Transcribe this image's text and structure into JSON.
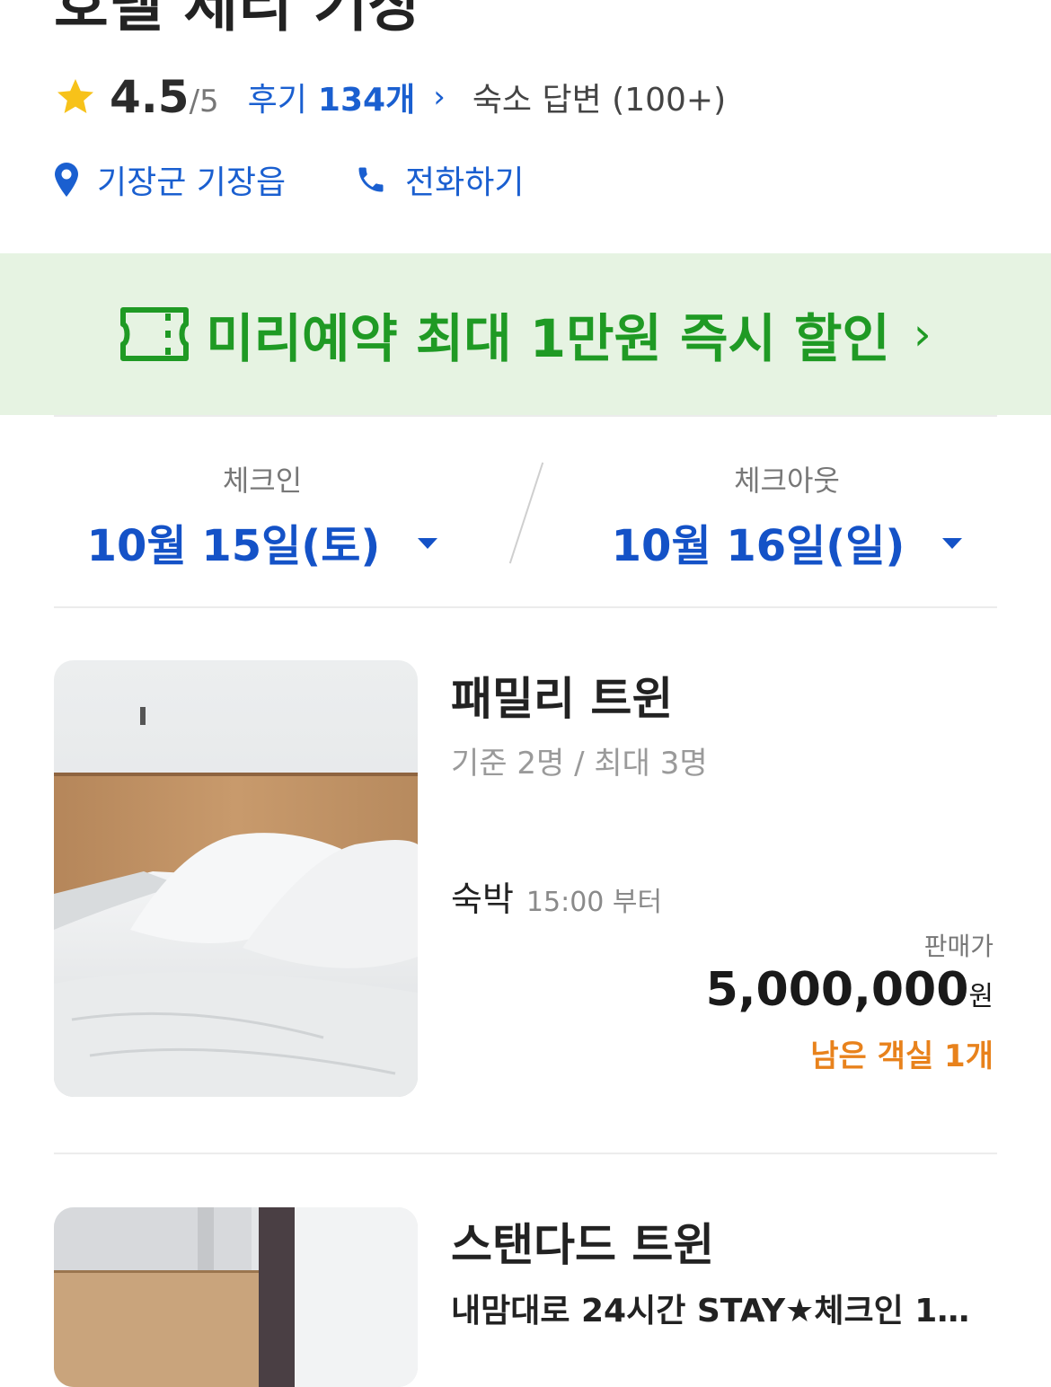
{
  "hotel": {
    "name": "호텔 제리 기장",
    "rating": "4.5",
    "rating_max": "/5",
    "review_label": "후기",
    "review_count": "134개",
    "owner_reply": "숙소 답변 (100+)",
    "location": "기장군 기장읍",
    "call_label": "전화하기"
  },
  "banner": {
    "text": "미리예약 최대 1만원 즉시 할인",
    "icon": "ticket-icon",
    "color": "#1f9a24",
    "background": "#e6f3e2"
  },
  "dates": {
    "checkin_label": "체크인",
    "checkin_value": "10월 15일(토)",
    "checkout_label": "체크아웃",
    "checkout_value": "10월 16일(일)"
  },
  "rooms": [
    {
      "name": "패밀리 트윈",
      "capacity": "기준 2명 / 최대 3명",
      "stay_type": "숙박",
      "stay_time": "15:00 부터",
      "price_label": "판매가",
      "price": "5,000,000",
      "price_unit": "원",
      "remaining": "남은 객실 1개"
    },
    {
      "name": "스탠다드 트윈",
      "promo": "내맘대로 24시간 STAY★체크인 1..."
    }
  ],
  "colors": {
    "accent": "#1a5fd0",
    "date": "#1452c7",
    "remaining": "#e8821c",
    "star": "#f7c21a"
  }
}
